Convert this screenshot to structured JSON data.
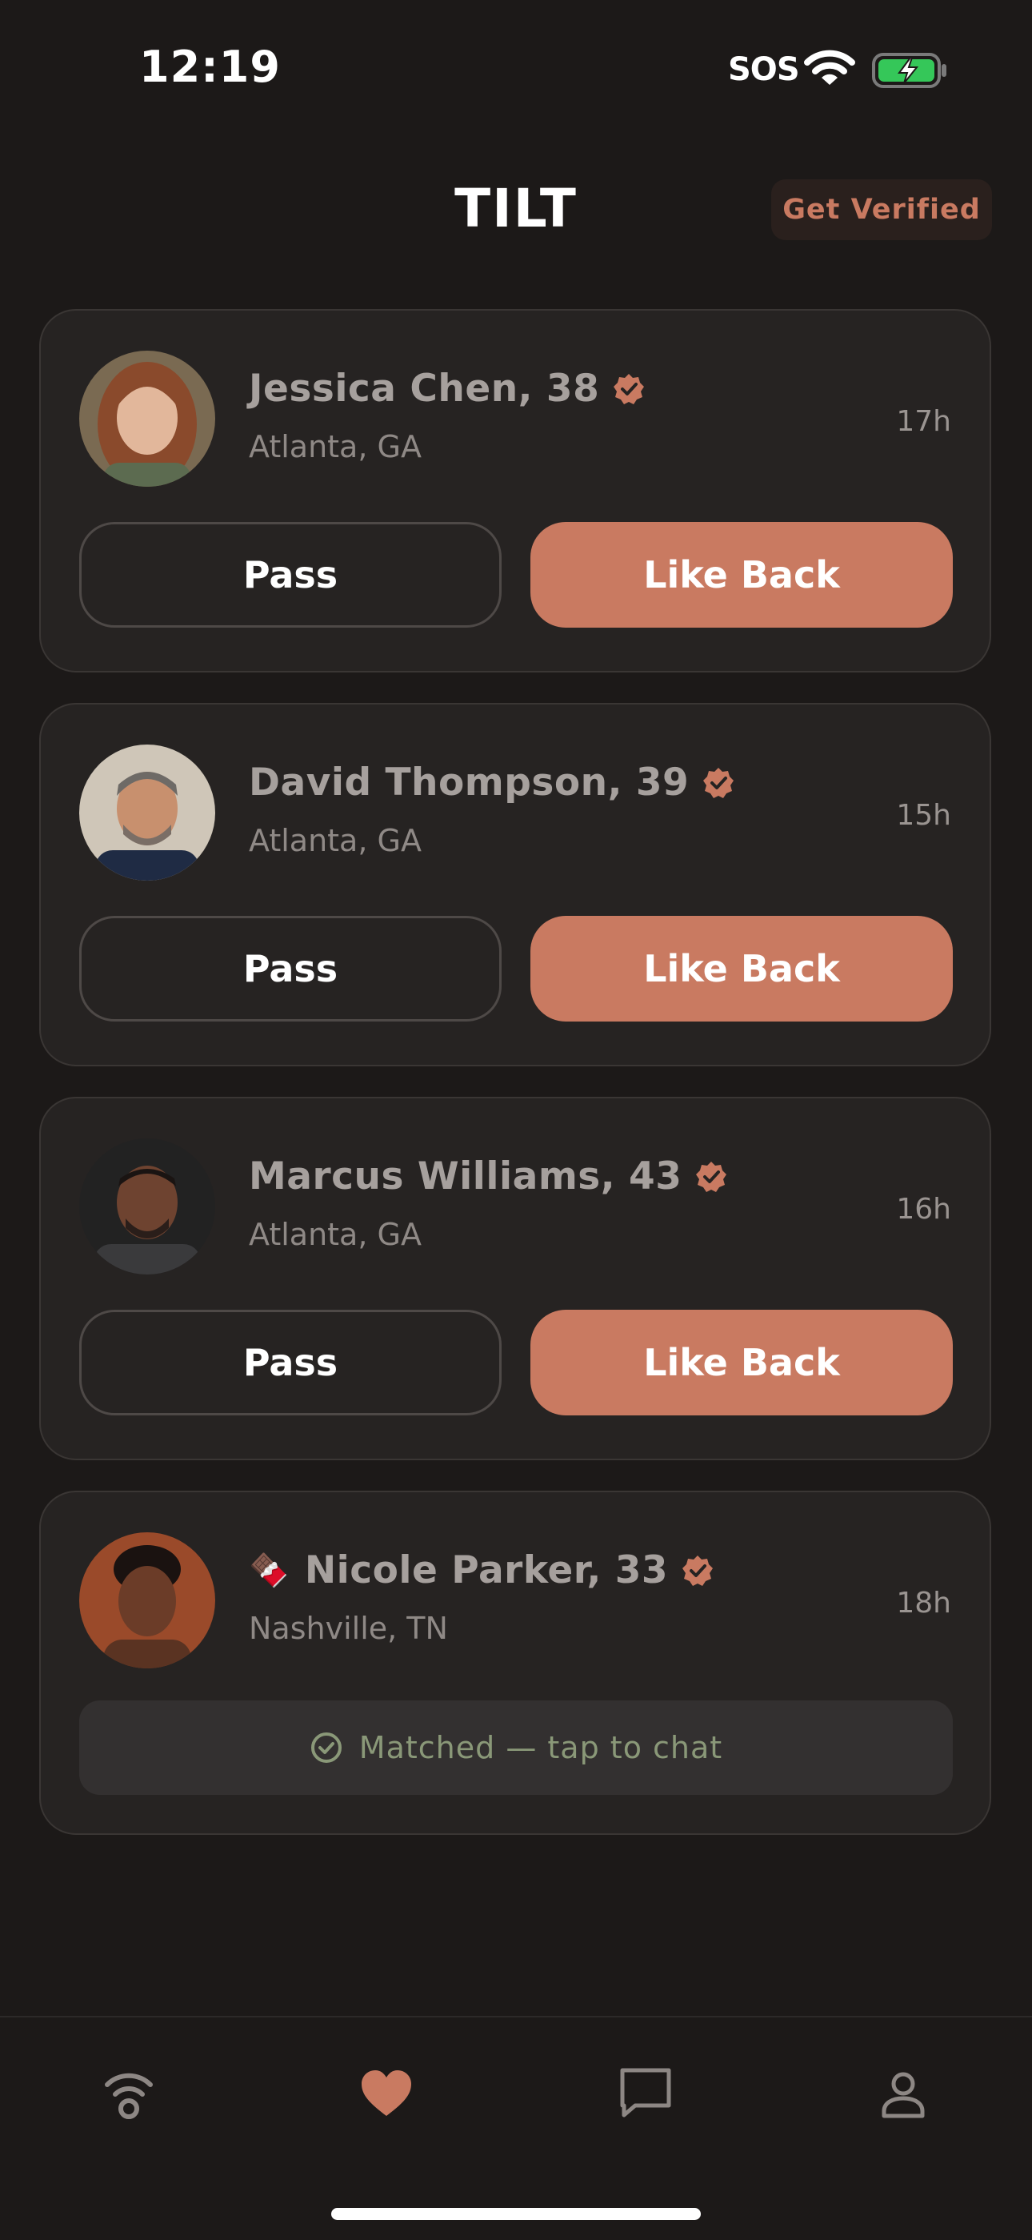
{
  "status_bar": {
    "time": "12:19",
    "sos": "SOS"
  },
  "header": {
    "title": "TILT",
    "verify_label": "Get Verified"
  },
  "colors": {
    "accent": "#c97a61",
    "background": "#1c1918",
    "card": "#262322",
    "matched_text": "#8a9878"
  },
  "likes": [
    {
      "name": "Jessica Chen, 38",
      "location": "Atlanta, GA",
      "time_ago": "17h",
      "pass_label": "Pass",
      "like_label": "Like Back",
      "verified": true
    },
    {
      "name": "David Thompson, 39",
      "location": "Atlanta, GA",
      "time_ago": "15h",
      "pass_label": "Pass",
      "like_label": "Like Back",
      "verified": true
    },
    {
      "name": "Marcus Williams, 43",
      "location": "Atlanta, GA",
      "time_ago": "16h",
      "pass_label": "Pass",
      "like_label": "Like Back",
      "verified": true
    },
    {
      "emoji": "🍫",
      "name": "Nicole Parker, 33",
      "location": "Nashville, TN",
      "time_ago": "18h",
      "matched_label": "Matched — tap to chat",
      "verified": true
    }
  ],
  "tab_bar": {
    "tabs": [
      {
        "icon": "signal-icon",
        "active": false
      },
      {
        "icon": "heart-icon",
        "active": true
      },
      {
        "icon": "chat-icon",
        "active": false
      },
      {
        "icon": "profile-icon",
        "active": false
      }
    ]
  }
}
